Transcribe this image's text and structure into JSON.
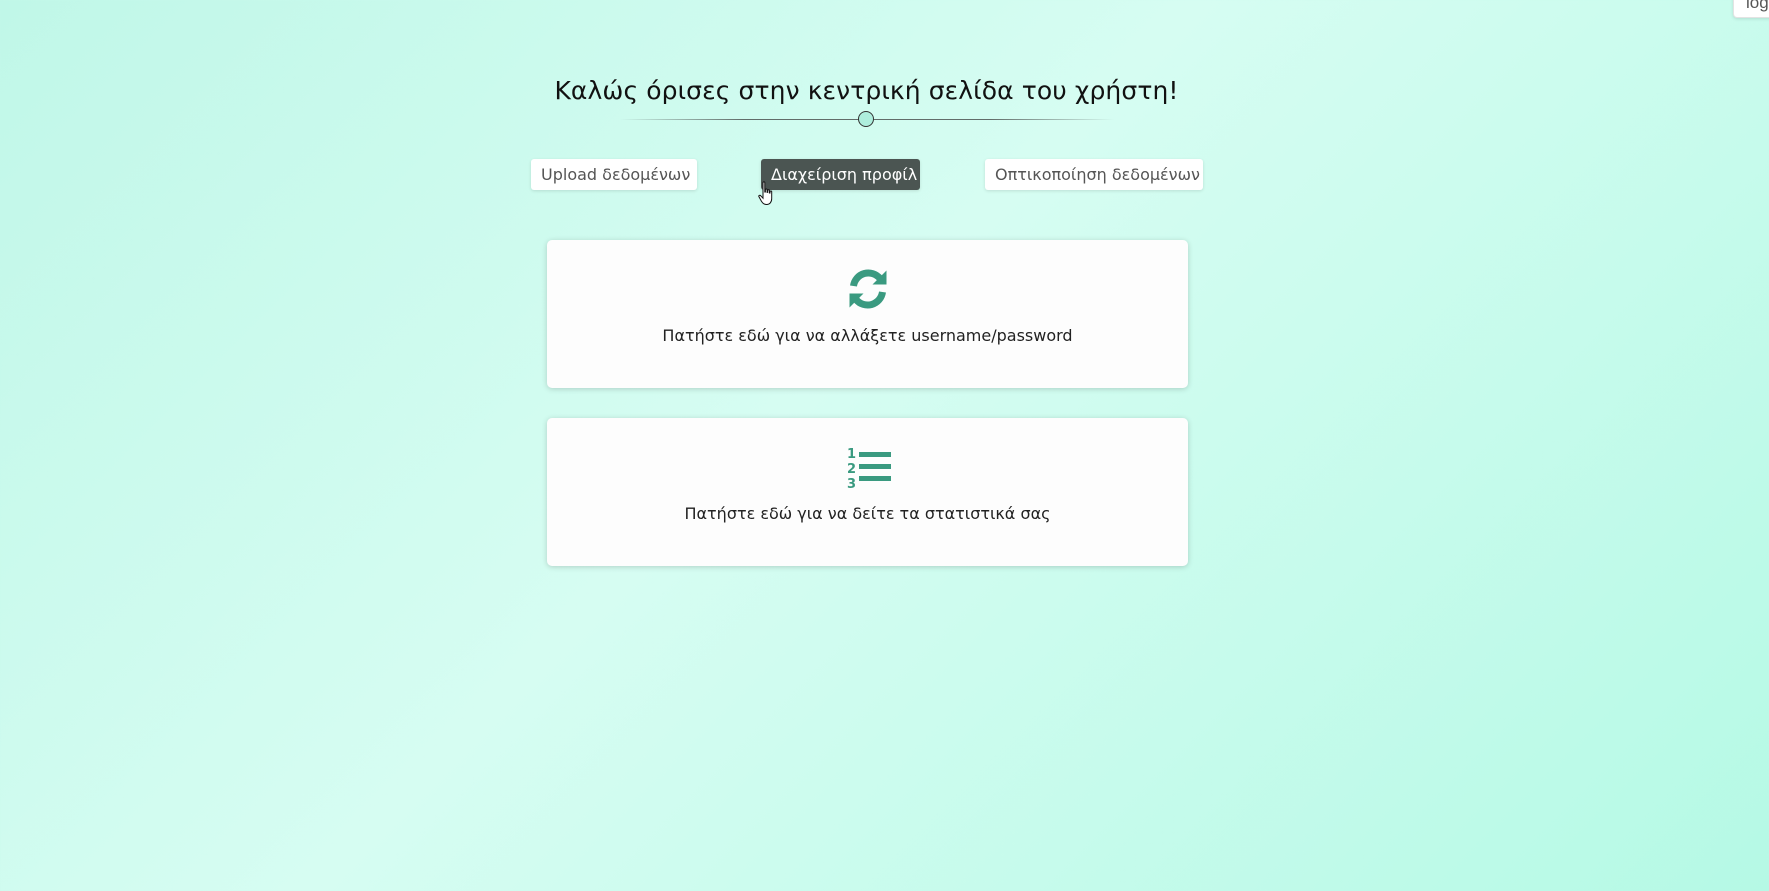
{
  "header": {
    "logout_label": "log",
    "title": "Καλώς όρισες στην κεντρική σελίδα του χρήστη!"
  },
  "nav": {
    "upload_label": "Upload δεδομένων",
    "profile_label": "Διαχείριση προφίλ",
    "visualize_label": "Οπτικοποίηση δεδομένων",
    "active_tab": "profile"
  },
  "cards": {
    "credentials": {
      "icon": "sync-icon",
      "text": "Πατήστε εδώ για να αλλάξετε username/password"
    },
    "stats": {
      "icon": "ordered-list-icon",
      "text": "Πατήστε εδώ για να δείτε τα στατιστικά σας"
    }
  },
  "colors": {
    "accent": "#3a9a80",
    "active_tab_bg": "#4b5552",
    "background_start": "#c0f7e8",
    "background_end": "#b5f9e5"
  }
}
